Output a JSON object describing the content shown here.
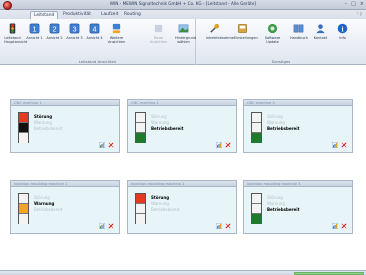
{
  "window": {
    "title": "WIN - MEWIN Signaltechnik GmbH + Co. KG - [Leitstand - Alle Geräte]",
    "controls": [
      "–",
      "□",
      "×"
    ]
  },
  "tabs": [
    {
      "label": "Leitstand",
      "active": true
    },
    {
      "label": "Produktivität",
      "active": false
    },
    {
      "label": "Laufzeit",
      "active": false
    },
    {
      "label": "Routing",
      "active": false
    }
  ],
  "ribbon_minimize": "˄ ?",
  "ribbon": {
    "groups": {
      "view_label": "Leitstand Ansichten",
      "system_label": "Sonstiges"
    },
    "buttons": [
      {
        "label": "Leitstand Hauptansicht",
        "icon": "dashboard-icon"
      },
      {
        "label": "Ansicht 1",
        "icon": "view-1-icon"
      },
      {
        "label": "Ansicht 2",
        "icon": "view-2-icon"
      },
      {
        "label": "Ansicht 3",
        "icon": "view-3-icon"
      },
      {
        "label": "Ansicht 4",
        "icon": "view-4-icon"
      },
      {
        "label": "Weitere Ansichten",
        "icon": "more-views-icon"
      },
      {
        "label": "Neue Ansichten",
        "icon": "new-views-icon",
        "disabled": true
      },
      {
        "label": "Hintergrund wählen",
        "icon": "background-icon"
      },
      {
        "label": "Inbetriebnahme",
        "icon": "commissioning-icon"
      },
      {
        "label": "Einstellungen",
        "icon": "settings-icon"
      },
      {
        "label": "Software Update",
        "icon": "software-update-icon"
      },
      {
        "label": "Handbuch",
        "icon": "manual-icon"
      },
      {
        "label": "Kontakt",
        "icon": "contact-icon"
      },
      {
        "label": "Info",
        "icon": "info-icon"
      }
    ]
  },
  "machines": [
    {
      "title": "CNC machine 1",
      "status_on": 0,
      "lamps": [
        "red",
        "black",
        "off"
      ]
    },
    {
      "title": "CNC machine 2",
      "status_on": 2,
      "lamps": [
        "off",
        "off",
        "green"
      ]
    },
    {
      "title": "CNC machine 3",
      "status_on": 2,
      "lamps": [
        "off",
        "off",
        "green"
      ]
    },
    {
      "title": "Injection moulding machine 1",
      "status_on": 1,
      "lamps": [
        "off",
        "amber",
        "off"
      ]
    },
    {
      "title": "Injection moulding machine 2",
      "status_on": 0,
      "lamps": [
        "red",
        "off",
        "off"
      ]
    },
    {
      "title": "Injection moulding machine 3",
      "status_on": 2,
      "lamps": [
        "off",
        "off",
        "green"
      ]
    }
  ],
  "status_labels": [
    "Störung",
    "Warnung",
    "Betriebsbereit"
  ],
  "colors": {
    "accent": "#2b5fa8",
    "error": "#e53a22",
    "warning": "#f2a51e",
    "ready": "#1f7a2c",
    "panel_bg": "#e8f5f8"
  }
}
